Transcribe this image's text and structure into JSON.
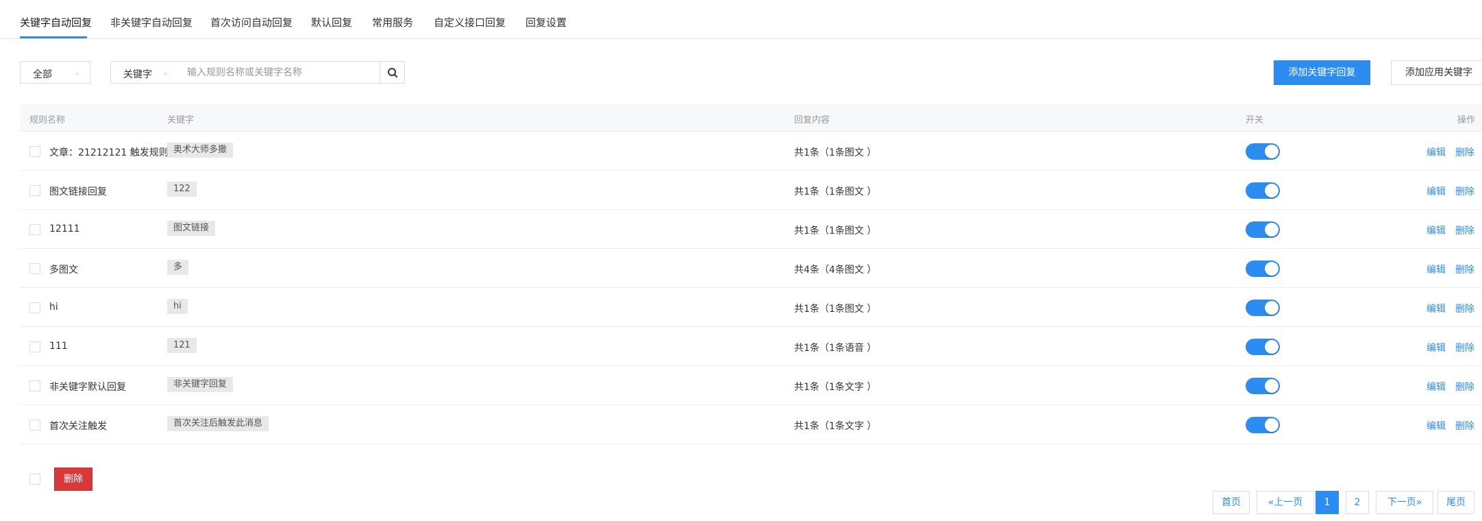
{
  "tabs": [
    {
      "label": "关键字自动回复",
      "active": true
    },
    {
      "label": "非关键字自动回复"
    },
    {
      "label": "首次访问自动回复"
    },
    {
      "label": "默认回复"
    },
    {
      "label": "常用服务"
    },
    {
      "label": "自定义接口回复"
    },
    {
      "label": "回复设置"
    }
  ],
  "filters": {
    "status_select": "全部",
    "type_select": "关键字",
    "search_placeholder": "输入规则名称或关键字名称"
  },
  "actions": {
    "add_keyword_reply": "添加关键字回复",
    "add_app_keyword": "添加应用关键字"
  },
  "table": {
    "headers": {
      "rule_name": "规则名称",
      "keyword": "关键字",
      "reply_content": "回复内容",
      "switch": "开关",
      "operation": "操作"
    },
    "edit_label": "编辑",
    "delete_label": "删除",
    "rows": [
      {
        "name": "文章：21212121 触发规则",
        "keyword": "奥术大师多撒",
        "content": "共1条（1条图文 ）",
        "on": true
      },
      {
        "name": "图文链接回复",
        "keyword": "122",
        "content": "共1条（1条图文 ）",
        "on": true
      },
      {
        "name": "12111",
        "keyword": "图文链接",
        "content": "共1条（1条图文 ）",
        "on": true
      },
      {
        "name": "多图文",
        "keyword": "多",
        "content": "共4条（4条图文 ）",
        "on": true
      },
      {
        "name": "hi",
        "keyword": "hi",
        "content": "共1条（1条图文 ）",
        "on": true
      },
      {
        "name": "111",
        "keyword": "121",
        "content": "共1条（1条语音 ）",
        "on": true
      },
      {
        "name": "非关键字默认回复",
        "keyword": "非关键字回复",
        "content": "共1条（1条文字 ）",
        "on": true
      },
      {
        "name": "首次关注触发",
        "keyword": "首次关注后触发此消息",
        "content": "共1条（1条文字 ）",
        "on": true
      }
    ]
  },
  "footer": {
    "bulk_delete": "删除"
  },
  "pagination": {
    "first": "首页",
    "prev": "«上一页",
    "pages": [
      "1",
      "2"
    ],
    "current": "1",
    "next": "下一页»",
    "last": "尾页"
  },
  "colors": {
    "accent": "#2d8cf0",
    "danger": "#d9383a"
  },
  "icons": {
    "search": "search-icon",
    "caret": "chevron-down-icon"
  }
}
